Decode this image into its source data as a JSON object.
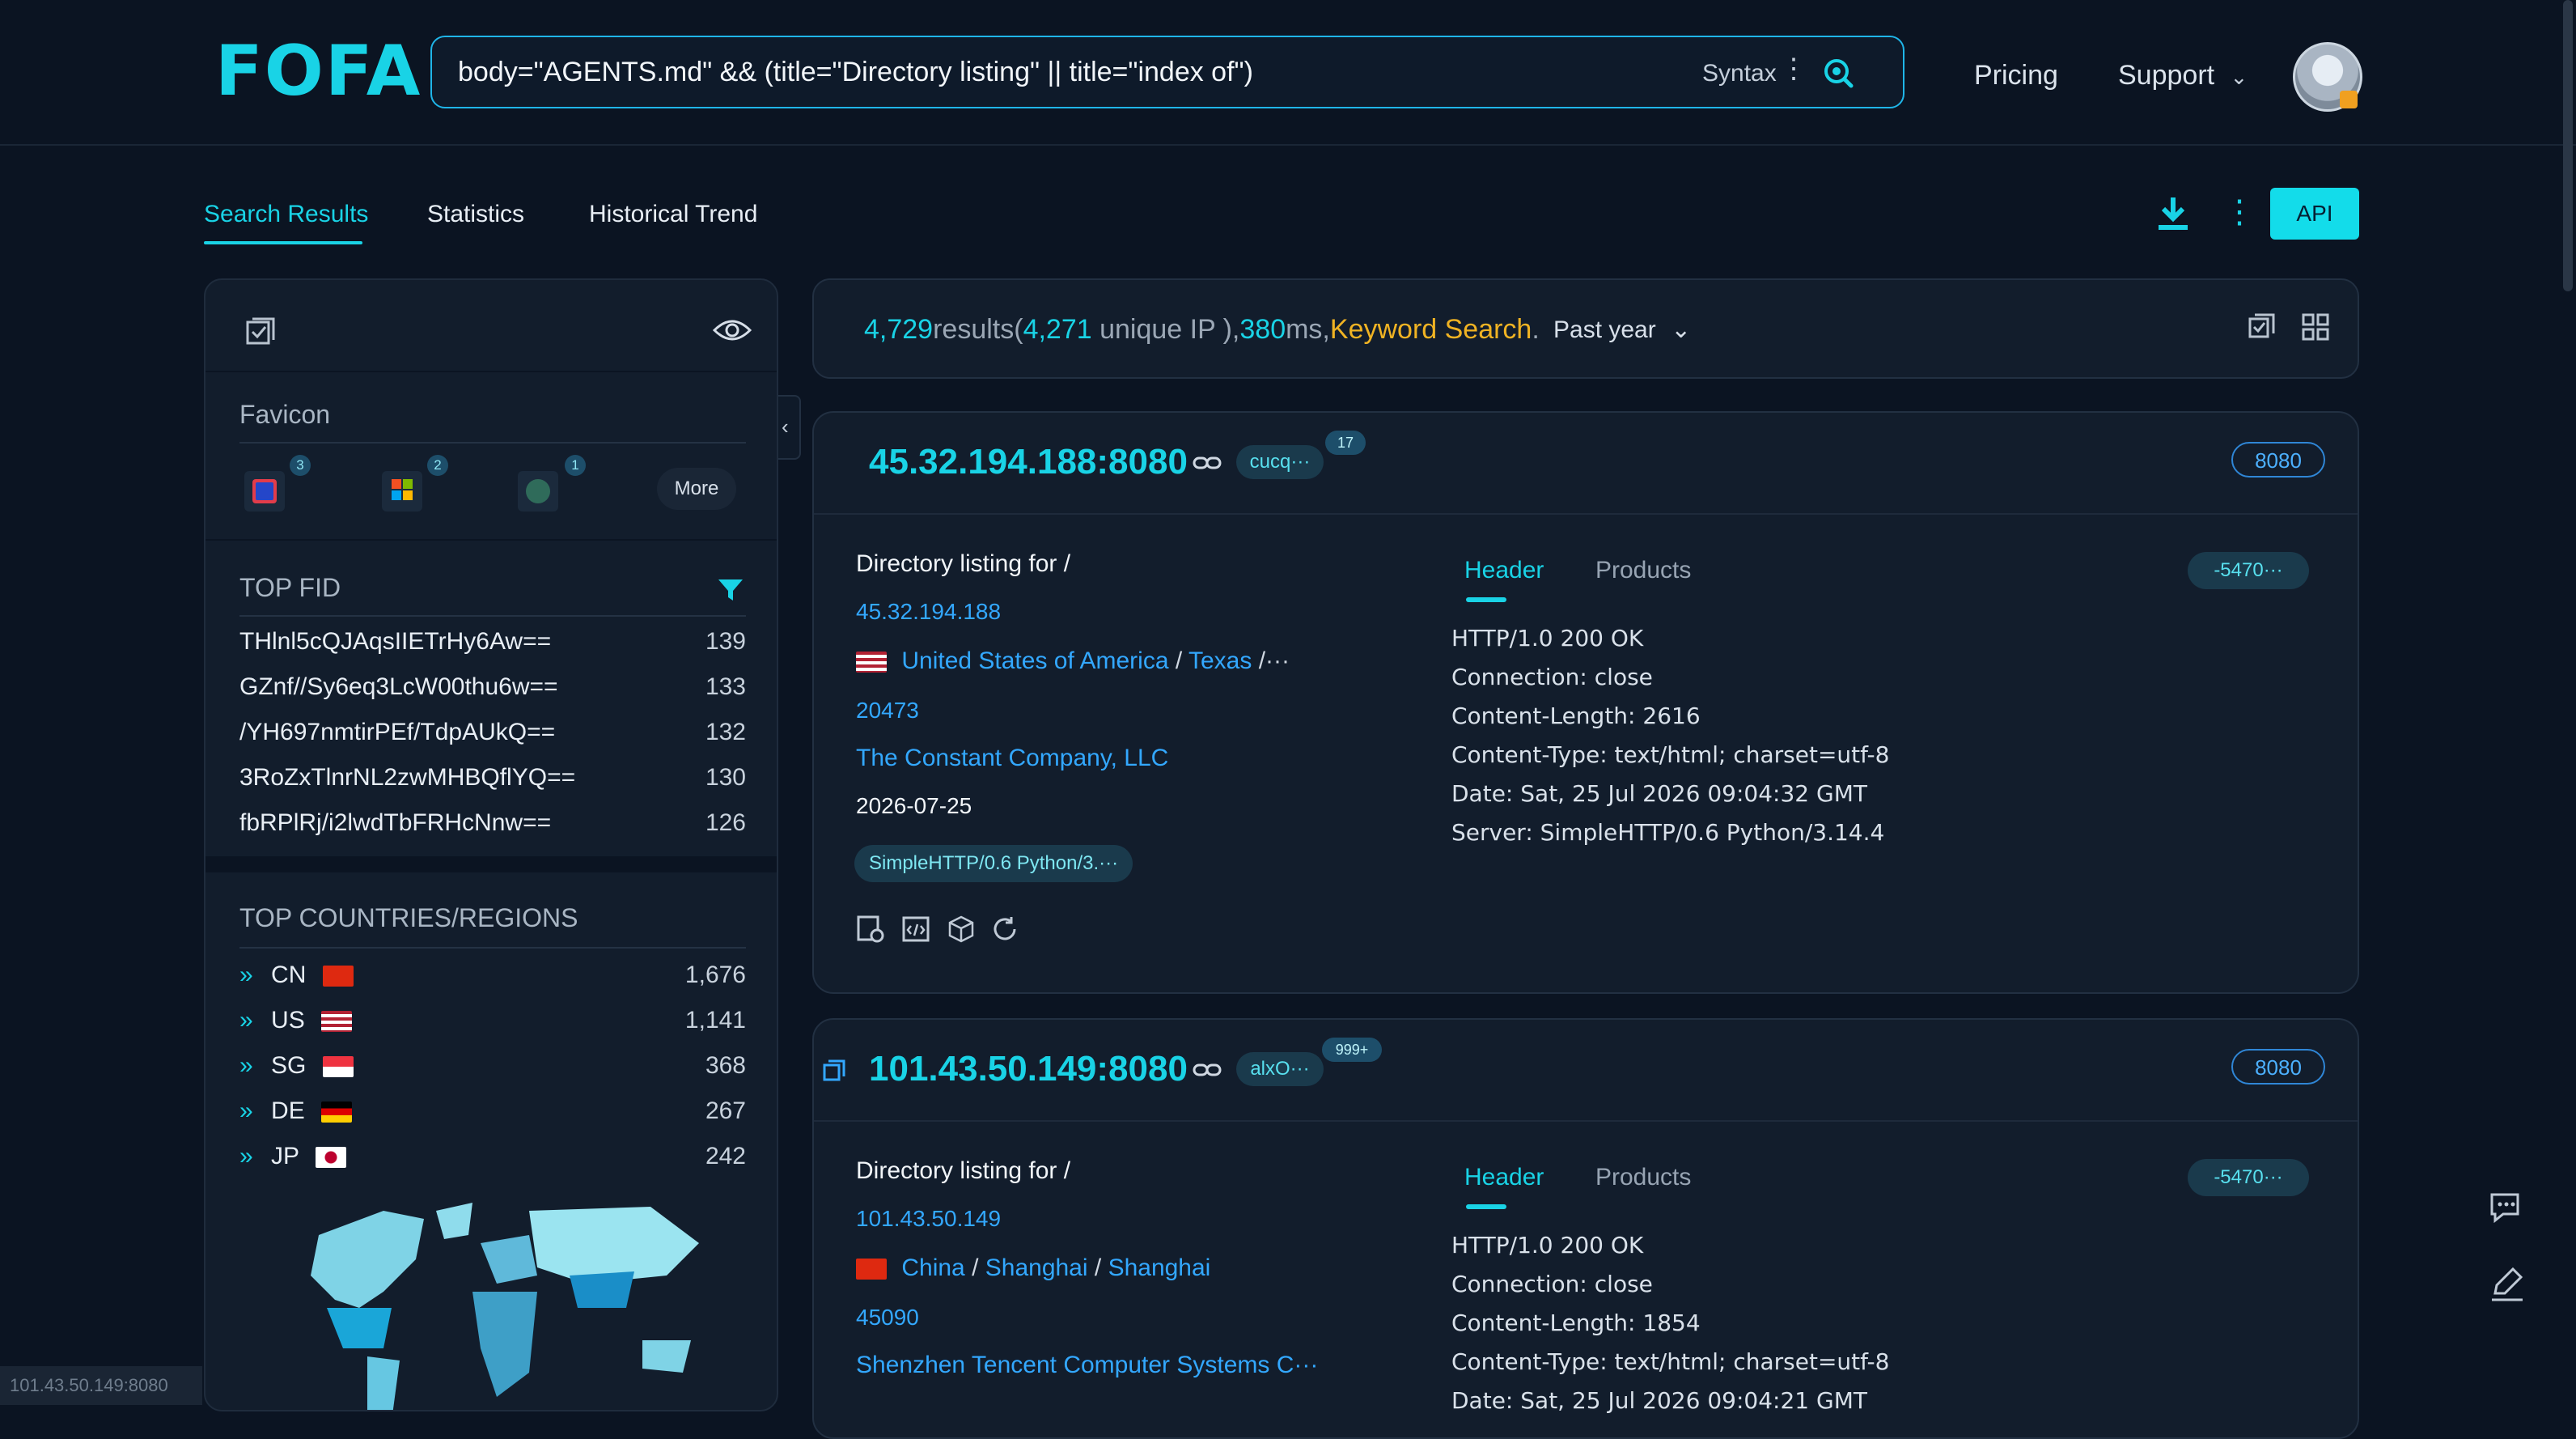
{
  "header": {
    "logo": "FOFA",
    "query": "body=\"AGENTS.md\" && (title=\"Directory listing\" || title=\"index of\")",
    "syntax_label": "Syntax",
    "nav": {
      "pricing": "Pricing",
      "support": "Support"
    }
  },
  "tabs": [
    {
      "label": "Search Results",
      "active": true
    },
    {
      "label": "Statistics",
      "active": false
    },
    {
      "label": "Historical Trend",
      "active": false
    }
  ],
  "toolbar": {
    "api_label": "API"
  },
  "sidebar": {
    "favicon_heading": "Favicon",
    "favicons": [
      {
        "icon": "mail-favicon-icon",
        "count": "3"
      },
      {
        "icon": "windows-favicon-icon",
        "count": "2"
      },
      {
        "icon": "nginx-favicon-icon",
        "count": "1"
      }
    ],
    "more_label": "More",
    "top_fid_heading": "TOP FID",
    "fids": [
      {
        "fid": "THlnl5cQJAqsIIETrHy6Aw==",
        "count": "139"
      },
      {
        "fid": "GZnf//Sy6eq3LcW00thu6w==",
        "count": "133"
      },
      {
        "fid": "/YH697nmtirPEf/TdpAUkQ==",
        "count": "132"
      },
      {
        "fid": "3RoZxTlnrNL2zwMHBQflYQ==",
        "count": "130"
      },
      {
        "fid": "fbRPlRj/i2lwdTbFRHcNnw==",
        "count": "126"
      }
    ],
    "countries_heading": "TOP COUNTRIES/REGIONS",
    "countries": [
      {
        "code": "CN",
        "count": "1,676"
      },
      {
        "code": "US",
        "count": "1,141"
      },
      {
        "code": "SG",
        "count": "368"
      },
      {
        "code": "DE",
        "count": "267"
      },
      {
        "code": "JP",
        "count": "242"
      }
    ]
  },
  "summary": {
    "results": "4,729",
    "results_word": "results(",
    "unique_ip": "4,271",
    "unique_ip_word": " unique IP ),",
    "ms": "380",
    "ms_word": "ms,",
    "mode": "Keyword Search",
    "period": "Past year"
  },
  "results": [
    {
      "ip_port": "45.32.194.188:8080",
      "domain_pill": "cucq···",
      "count_badge": "17",
      "port": "8080",
      "title": "Directory listing for /",
      "ip": "45.32.194.188",
      "country": "United States of America",
      "region": "Texas",
      "region_more": "/···",
      "asn": "20473",
      "org": "The Constant Company, LLC",
      "date": "2026-07-25",
      "tag": "SimpleHTTP/0.6 Python/3.···",
      "tab_header": "Header",
      "tab_products": "Products",
      "hash_pill": "-5470···",
      "header_lines": [
        "HTTP/1.0 200 OK",
        "Connection: close",
        "Content-Length: 2616",
        "Content-Type: text/html; charset=utf-8",
        "Date: Sat, 25 Jul 2026 09:04:32 GMT",
        "Server: SimpleHTTP/0.6 Python/3.14.4"
      ]
    },
    {
      "ip_port": "101.43.50.149:8080",
      "domain_pill": "alxO···",
      "count_badge": "999+",
      "port": "8080",
      "title": "Directory listing for /",
      "ip": "101.43.50.149",
      "country": "China",
      "region": "Shanghai",
      "city": "Shanghai",
      "asn": "45090",
      "org": "Shenzhen Tencent Computer Systems C···",
      "tab_header": "Header",
      "tab_products": "Products",
      "hash_pill": "-5470···",
      "header_lines": [
        "HTTP/1.0 200 OK",
        "Connection: close",
        "Content-Length: 1854",
        "Content-Type: text/html; charset=utf-8",
        "Date: Sat, 25 Jul 2026 09:04:21 GMT"
      ]
    }
  ],
  "status_url": "101.43.50.149:8080"
}
